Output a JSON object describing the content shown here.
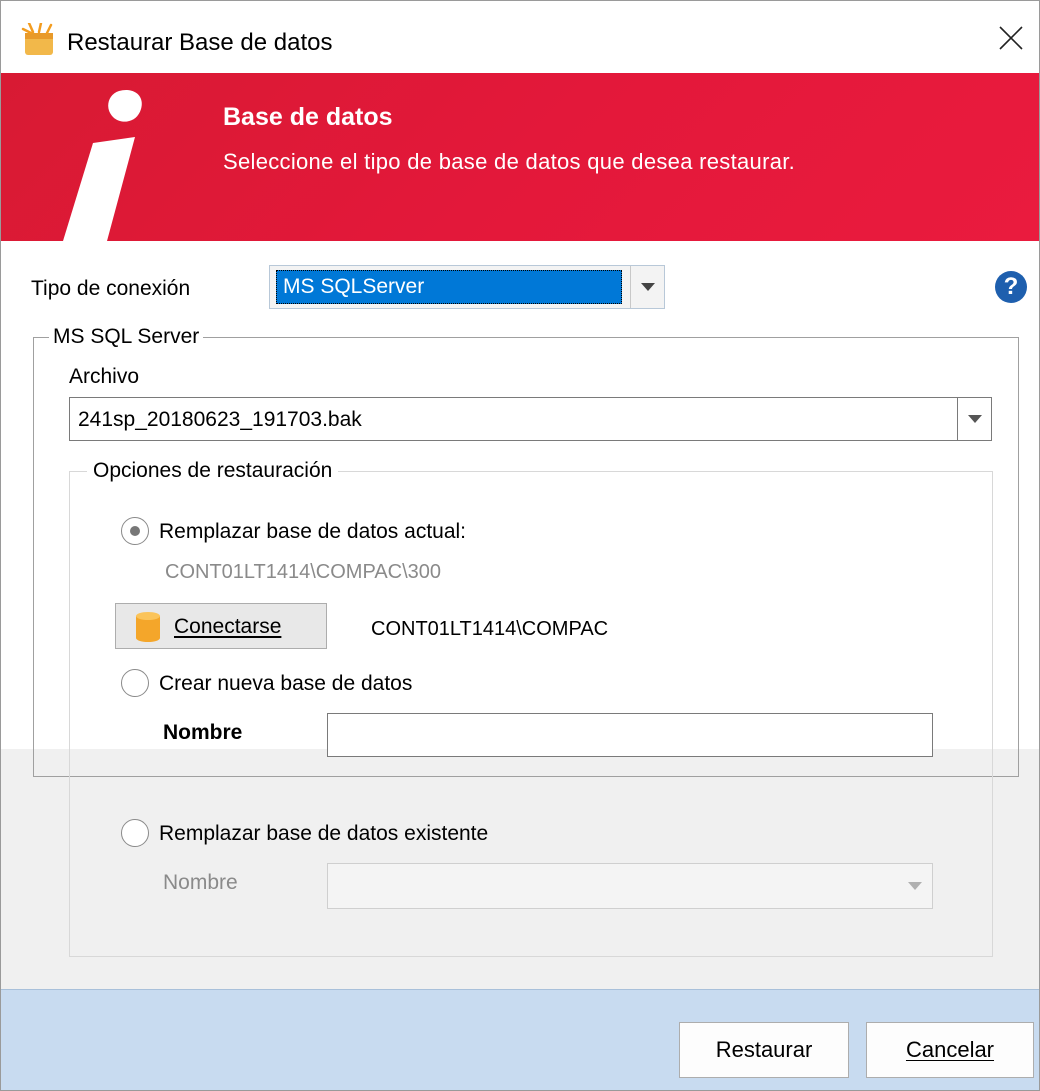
{
  "window": {
    "title": "Restaurar Base de datos",
    "close_glyph": "✕"
  },
  "banner": {
    "title": "Base de datos",
    "subtitle": "Seleccione el tipo de base de datos que desea restaurar."
  },
  "connection": {
    "label": "Tipo de conexión",
    "selected": "MS SQLServer",
    "help_glyph": "?"
  },
  "sql_group": {
    "title": "MS SQL Server",
    "archivo_label": "Archivo",
    "archivo_value": "241sp_20180623_191703.bak"
  },
  "options": {
    "title": "Opciones de restauración",
    "replace_current_label": "Remplazar base de datos actual:",
    "replace_current_server": "CONT01LT1414\\COMPAC\\300",
    "connect_button": "Conectarse",
    "server_name": "CONT01LT1414\\COMPAC",
    "create_new_label": "Crear nueva base de datos",
    "create_new_name_label": "Nombre",
    "create_new_name_value": "",
    "replace_existing_label": "Remplazar base de datos existente",
    "replace_existing_name_label": "Nombre",
    "replace_existing_value": ""
  },
  "footer": {
    "restore_button": "Restaurar",
    "cancel_button": "Cancelar"
  },
  "icons": {
    "app": "app-logo-icon",
    "close": "close-icon",
    "help": "help-icon",
    "dropdown": "chevron-down-icon",
    "database": "database-icon"
  },
  "colors": {
    "banner": "#e3183a",
    "selection": "#0078d7",
    "footer": "#c8dbf0",
    "help": "#1e5fae"
  }
}
